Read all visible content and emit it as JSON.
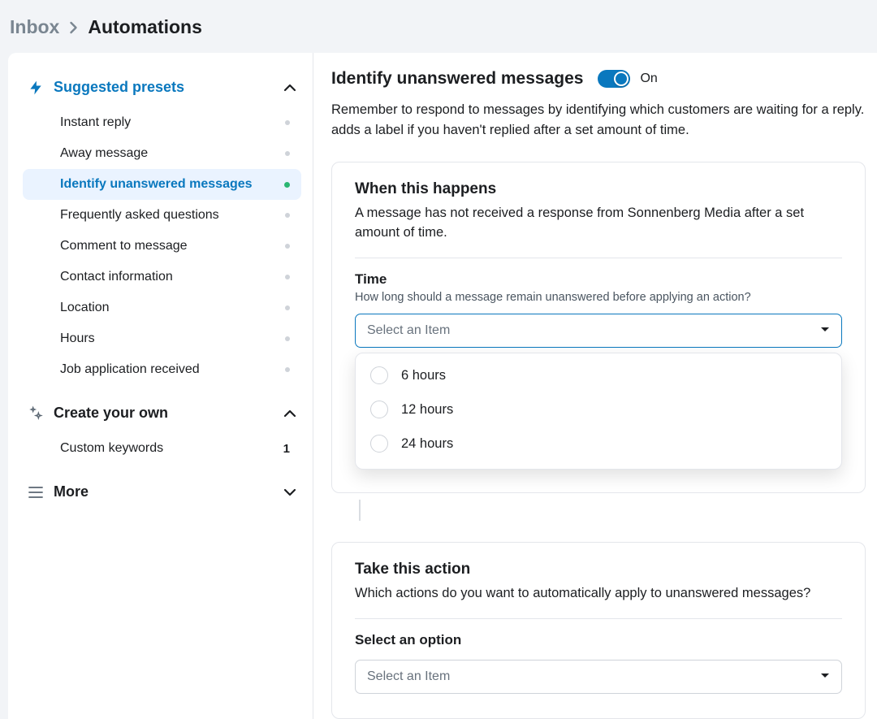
{
  "breadcrumb": {
    "parent": "Inbox",
    "current": "Automations"
  },
  "sidebar": {
    "suggested_title": "Suggested presets",
    "own_title": "Create your own",
    "more_title": "More",
    "presets": [
      {
        "label": "Instant reply"
      },
      {
        "label": "Away message"
      },
      {
        "label": "Identify unanswered messages"
      },
      {
        "label": "Frequently asked questions"
      },
      {
        "label": "Comment to message"
      },
      {
        "label": "Contact information"
      },
      {
        "label": "Location"
      },
      {
        "label": "Hours"
      },
      {
        "label": "Job application received"
      }
    ],
    "own_items": [
      {
        "label": "Custom keywords",
        "count": "1"
      }
    ]
  },
  "main": {
    "title": "Identify unanswered messages",
    "toggle_label": "On",
    "description": "Remember to respond to messages by identifying which customers are waiting for a reply. adds a label if you haven't replied after a set amount of time.",
    "card1": {
      "heading": "When this happens",
      "subtitle": "A message has not received a response from Sonnenberg Media after a set amount of time.",
      "time_label": "Time",
      "time_help": "How long should a message remain unanswered before applying an action?",
      "select_placeholder": "Select an Item",
      "options": [
        "6 hours",
        "12 hours",
        "24 hours"
      ]
    },
    "card2": {
      "heading": "Take this action",
      "subtitle": "Which actions do you want to automatically apply to unanswered messages?",
      "option_label": "Select an option",
      "select_placeholder": "Select an Item"
    }
  }
}
